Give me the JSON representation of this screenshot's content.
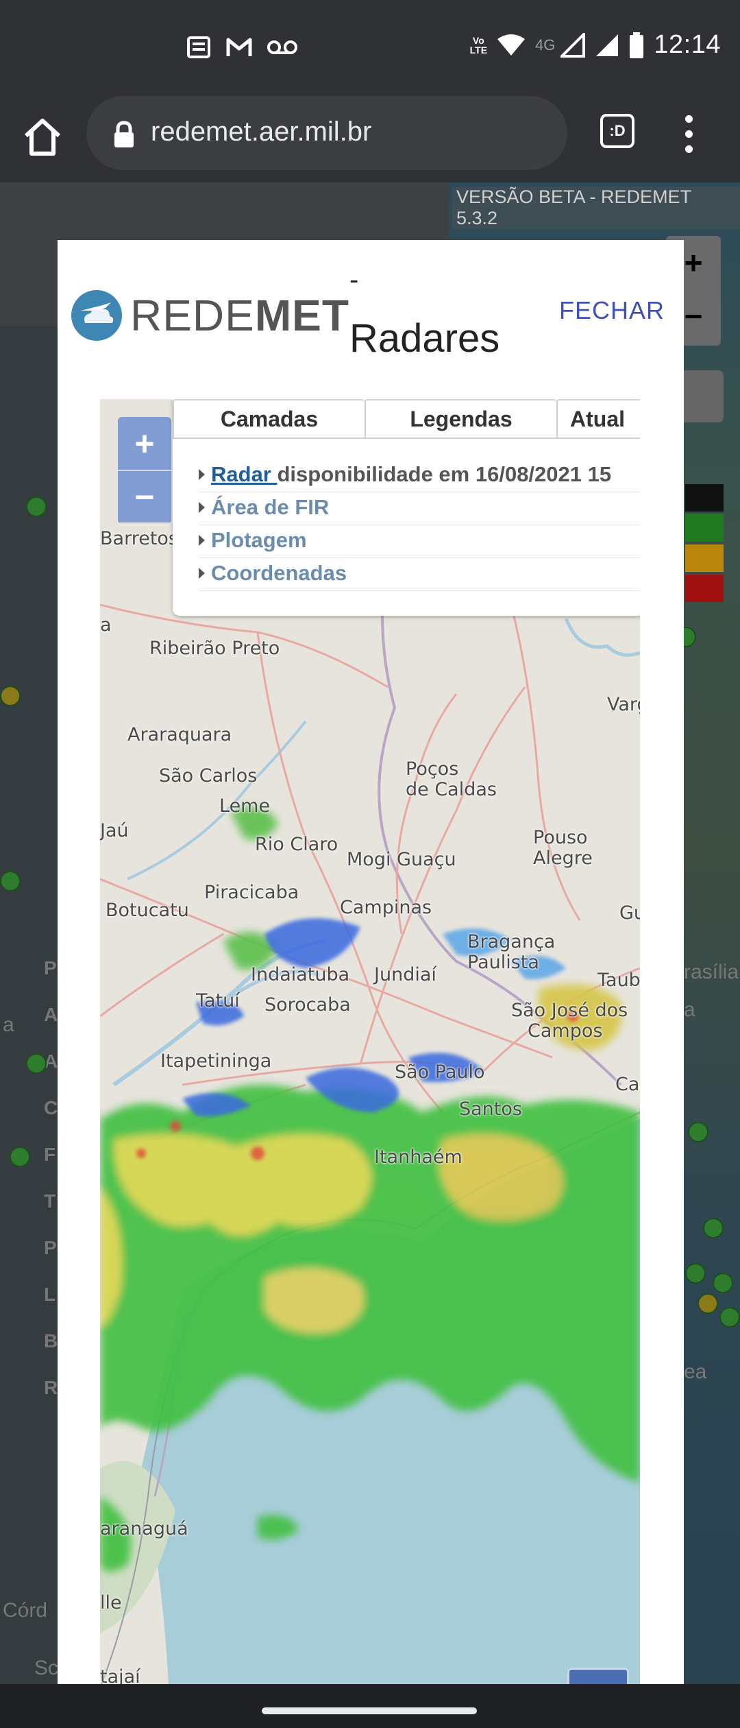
{
  "status_bar": {
    "time": "12:14",
    "network": "4G",
    "volte_label": "Vo LTE",
    "notification_icons": [
      "news-icon",
      "gmail-icon",
      "voicemail-icon"
    ],
    "system_icons": [
      "wifi-icon",
      "signal-icon",
      "signal-icon",
      "battery-icon"
    ]
  },
  "browser": {
    "url": "redemet.aer.mil.br",
    "tab_switcher_label": ":D"
  },
  "background_page": {
    "version_label": "VERSÃO BETA - REDEMET 5.3.2",
    "zoom_in_label": "+",
    "zoom_out_label": "−",
    "sidebar_letters": [
      "P",
      "A",
      "A",
      "C",
      "F",
      "T",
      "P",
      "L",
      "B",
      "R"
    ],
    "map_labels": [
      "Córd",
      "Sc",
      "rasília",
      "a",
      "ea",
      "a"
    ],
    "legend_colors": [
      "#111111",
      "#1f7a1f",
      "#b8860b",
      "#a01010"
    ]
  },
  "modal": {
    "logo_text_light": "REDE",
    "logo_text_bold": "MET",
    "title_dash": "-",
    "title": "Radares",
    "close_label": "FECHAR",
    "zoom_in_label": "+",
    "zoom_out_label": "−",
    "tabs": [
      "Camadas",
      "Legendas",
      "Atual"
    ],
    "layers": [
      {
        "link": "Radar ",
        "text": "disponibilidade em 16/08/2021 15"
      },
      {
        "text": "Área de FIR"
      },
      {
        "text": "Plotagem"
      },
      {
        "text": "Coordenadas"
      }
    ],
    "city_labels": [
      "Barretos",
      "Ribeirão Preto",
      "Araraquara",
      "São Carlos",
      "Leme",
      "Poços",
      "de Caldas",
      "Varg",
      "Jaú",
      "Rio Claro",
      "Mogi Guaçu",
      "Pouso",
      "Alegre",
      "Piracicaba",
      "Campinas",
      "Botucatu",
      "Bragança",
      "Paulista",
      "Gu",
      "Taubat",
      "Indaiatuba",
      "Jundiaí",
      "Tatuí",
      "Sorocaba",
      "São José dos",
      "Campos",
      "Itapetininga",
      "São Paulo",
      "Carague",
      "Santos",
      "Itanhaém",
      "aranaguá",
      "lle",
      "tajaí",
      "a"
    ]
  }
}
